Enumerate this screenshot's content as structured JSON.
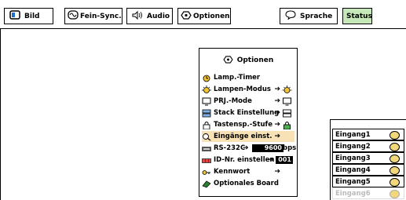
{
  "toolbar": {
    "bild": "Bild",
    "feinsync": "Fein-Sync.",
    "audio": "Audio",
    "optionen": "Optionen",
    "sprache": "Sprache",
    "status": "Status"
  },
  "menu": {
    "title": "Optionen",
    "items": [
      {
        "label": "Lamp.-Timer",
        "icon": "lamp-timer-icon"
      },
      {
        "label": "Lampen-Modus",
        "icon": "lamp-mode-icon",
        "arrow": "➔"
      },
      {
        "label": "PRJ.-Mode",
        "icon": "projector-mode-icon",
        "arrow": "➔"
      },
      {
        "label": "Stack Einstellung",
        "icon": "stack-icon",
        "arrow": "➔"
      },
      {
        "label": "Tastensp.-Stufe",
        "icon": "key-lock-icon",
        "arrow": "➔"
      },
      {
        "label": "Eingänge einst.",
        "icon": "input-settings-icon",
        "arrow": "➔"
      },
      {
        "label": "RS-232C",
        "icon": "rs232c-icon",
        "arrow": "➔",
        "value": "9600",
        "unit": "bps"
      },
      {
        "label": "ID-Nr. einstellen",
        "icon": "id-number-icon",
        "arrow": "➔",
        "value": "001"
      },
      {
        "label": "Kennwort",
        "icon": "password-icon",
        "arrow": "➔"
      },
      {
        "label": "Optionales Board",
        "icon": "optional-board-icon"
      }
    ]
  },
  "submenu": {
    "items": [
      "Eingang1",
      "Eingang2",
      "Eingang3",
      "Eingang4",
      "Eingang5",
      "Eingang6"
    ]
  },
  "colors": {
    "selected": "#f8e2b5",
    "status_button": "#c6e8b8",
    "toggle": "#f2d77b"
  }
}
